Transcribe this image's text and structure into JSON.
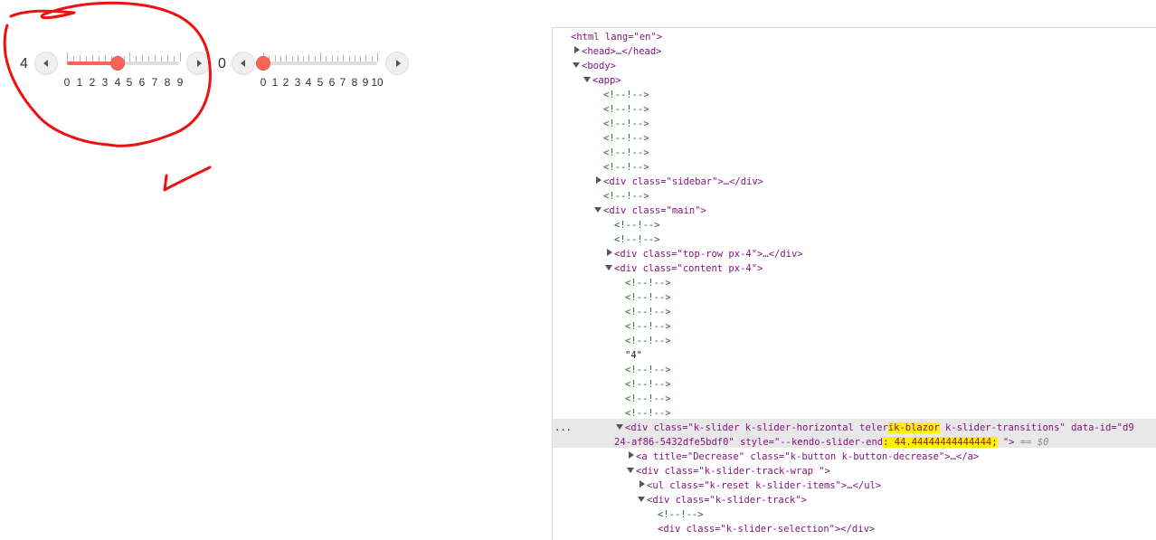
{
  "sliders": [
    {
      "value_text": "4",
      "value": 4,
      "min": 0,
      "max": 9,
      "ticks": [
        "0",
        "1",
        "2",
        "3",
        "4",
        "5",
        "6",
        "7",
        "8",
        "9"
      ]
    },
    {
      "value_text": "0",
      "value": 0,
      "min": 0,
      "max": 10,
      "ticks": [
        "0",
        "1",
        "2",
        "3",
        "4",
        "5",
        "6",
        "7",
        "8",
        "9",
        "10"
      ]
    }
  ],
  "colors": {
    "accent": "#ff6358",
    "annotation": "#ee1111",
    "highlight": "#fff200"
  },
  "devtools": {
    "html_open": "<html lang=\"en\">",
    "head": "<head>…</head>",
    "body": "<body>",
    "app": "<app>",
    "comment": "<!--!-->",
    "sidebar": "<div class=\"sidebar\">…</div>",
    "main": "<div class=\"main\">",
    "top_row": "<div class=\"top-row px-4\">…</div>",
    "content": "<div class=\"content px-4\">",
    "text_node": "\"4\"",
    "slider_l1a": "<div class=\"k-slider k-slider-horizontal teler",
    "slider_l1h": "ik-blazor",
    "slider_l1b": " k-slider-transitions\" data-id=\"d9",
    "slider_l2a": "24-af86-5432dfe5bdf0\" style=\"--kendo-slider-end",
    "slider_l2h": ": 44.44444444444444;",
    "slider_l2b": " \">",
    "slider_eq": "== $0",
    "ellipsis": "...",
    "decrease": "<a title=\"Decrease\" class=\"k-button k-button-decrease\">…</a>",
    "track_wrap": "<div class=\"k-slider-track-wrap \">",
    "items": "<ul class=\"k-reset k-slider-items\">…</ul>",
    "track": "<div class=\"k-slider-track\">",
    "selection": "<div class=\"k-slider-selection\"></div>"
  }
}
